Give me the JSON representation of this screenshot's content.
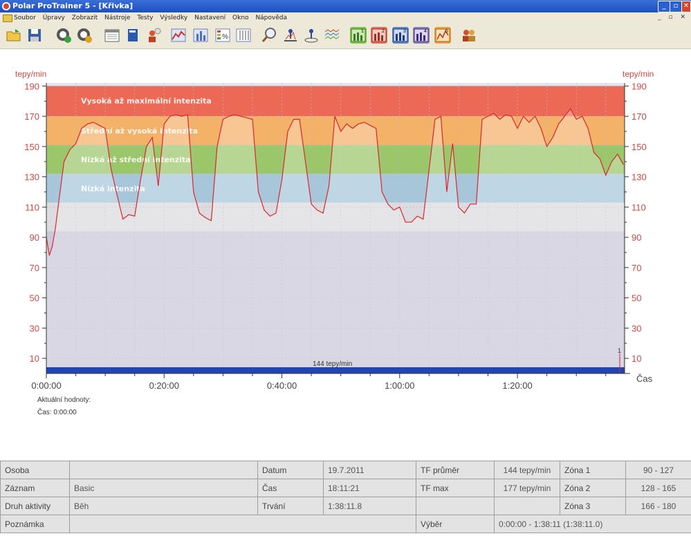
{
  "window": {
    "title": "Polar ProTrainer 5 - [Křivka]"
  },
  "menu": [
    "Soubor",
    "Úpravy",
    "Zobrazit",
    "Nástroje",
    "Testy",
    "Výsledky",
    "Nastavení",
    "Okno",
    "Nápověda"
  ],
  "toolbar_icons": [
    "open-folder-icon",
    "save-icon",
    "sync-icon",
    "settings-user-icon",
    "calendar-icon",
    "diary-icon",
    "user-icon",
    "curve-icon",
    "bars-icon",
    "percent-icon",
    "table-icon",
    "zoom-icon",
    "lap-icon",
    "marker-icon",
    "multi-curve-icon",
    "view1-icon",
    "view2-icon",
    "view3-icon",
    "view4-icon",
    "view5-icon",
    "users-icon"
  ],
  "chart": {
    "y_label_left": "tepy/min",
    "y_label_right": "tepy/min",
    "x_label": "Čas",
    "avg_bar_label": "144 tepy/min",
    "marker_label": "1",
    "current_values_label": "Aktuální hodnoty:",
    "current_time_label": "Čas: 0:00:00"
  },
  "chart_data": {
    "type": "line",
    "title": "",
    "xlabel": "Čas",
    "ylabel": "tepy/min",
    "ylim": [
      0,
      192
    ],
    "y_ticks": [
      10,
      30,
      50,
      70,
      90,
      110,
      130,
      150,
      170,
      190
    ],
    "x_ticks": [
      "0:00:00",
      "0:20:00",
      "0:40:00",
      "1:00:00",
      "1:20:00"
    ],
    "x_tick_minutes": [
      0,
      20,
      40,
      60,
      80
    ],
    "x_max_minutes": 98.2,
    "zones": [
      {
        "name": "Vysoká až maximální intenzita",
        "from": 170,
        "to": 190,
        "color": "#ec6a55"
      },
      {
        "name": "Střední až vysoká intenzita",
        "from": 151,
        "to": 170,
        "color": "#f4b168"
      },
      {
        "name": "Nízká až střední intenzita",
        "from": 132,
        "to": 151,
        "color": "#9cc66a"
      },
      {
        "name": "Nízká intenzita",
        "from": 113,
        "to": 132,
        "color": "#a7c6da"
      }
    ],
    "series": [
      {
        "x": [
          0,
          0.5,
          1,
          1.5,
          2,
          3,
          4,
          5,
          6,
          7,
          8,
          9,
          10,
          11,
          12,
          13,
          14,
          15,
          16,
          17,
          18,
          19,
          20,
          21,
          22,
          23,
          24,
          25,
          26,
          27,
          28,
          29,
          30,
          31,
          32,
          33,
          34,
          35,
          36,
          37,
          38,
          39,
          40,
          41,
          42,
          43,
          44,
          45,
          46,
          47,
          48,
          49,
          50,
          51,
          52,
          53,
          54,
          55,
          56,
          57,
          58,
          59,
          60,
          61,
          62,
          63,
          64,
          65,
          66,
          67,
          68,
          69,
          70,
          71,
          72,
          73,
          74,
          75,
          76,
          77,
          78,
          79,
          80,
          81,
          82,
          83,
          84,
          85,
          86,
          87,
          88,
          89,
          90,
          91,
          92,
          93,
          94,
          95,
          96,
          97,
          98
        ],
        "values": [
          90,
          78,
          84,
          95,
          110,
          140,
          148,
          152,
          162,
          165,
          166,
          164,
          162,
          135,
          118,
          102,
          105,
          104,
          128,
          150,
          156,
          124,
          165,
          170,
          171,
          170,
          171,
          120,
          106,
          103,
          101,
          150,
          168,
          170,
          171,
          170,
          169,
          168,
          120,
          108,
          104,
          106,
          128,
          160,
          168,
          168,
          140,
          112,
          108,
          106,
          124,
          170,
          160,
          165,
          162,
          165,
          166,
          164,
          162,
          120,
          112,
          108,
          110,
          100,
          100,
          104,
          102,
          135,
          168,
          170,
          120,
          152,
          110,
          106,
          112,
          112,
          168,
          170,
          172,
          168,
          171,
          170,
          162,
          170,
          166,
          170,
          162,
          150,
          156,
          165,
          170,
          175,
          168,
          170,
          162,
          146,
          142,
          131,
          140,
          145,
          138
        ]
      }
    ]
  },
  "info_table": {
    "rows": [
      [
        "Osoba",
        "",
        "Datum",
        "19.7.2011",
        "TF průměr",
        "144 tepy/min",
        "Zóna 1",
        "90 - 127"
      ],
      [
        "Záznam",
        "Basic",
        "Čas",
        "18:11:21",
        "TF max",
        "177 tepy/min",
        "Zóna 2",
        "128 - 165"
      ],
      [
        "Druh aktivity",
        "Běh",
        "Trvání",
        "1:38:11.8",
        "",
        "",
        "Zóna 3",
        "166 - 180"
      ]
    ],
    "note_label": "Poznámka",
    "note_value": "",
    "selection_label": "Výběr",
    "selection_value": "0:00:00 - 1:38:11 (1:38:11.0)"
  },
  "colors": {
    "line": "#d9262e",
    "avg_bar": "#2046b4",
    "plot_bg": "#c9c8d8",
    "axis_text": "#d94545"
  }
}
